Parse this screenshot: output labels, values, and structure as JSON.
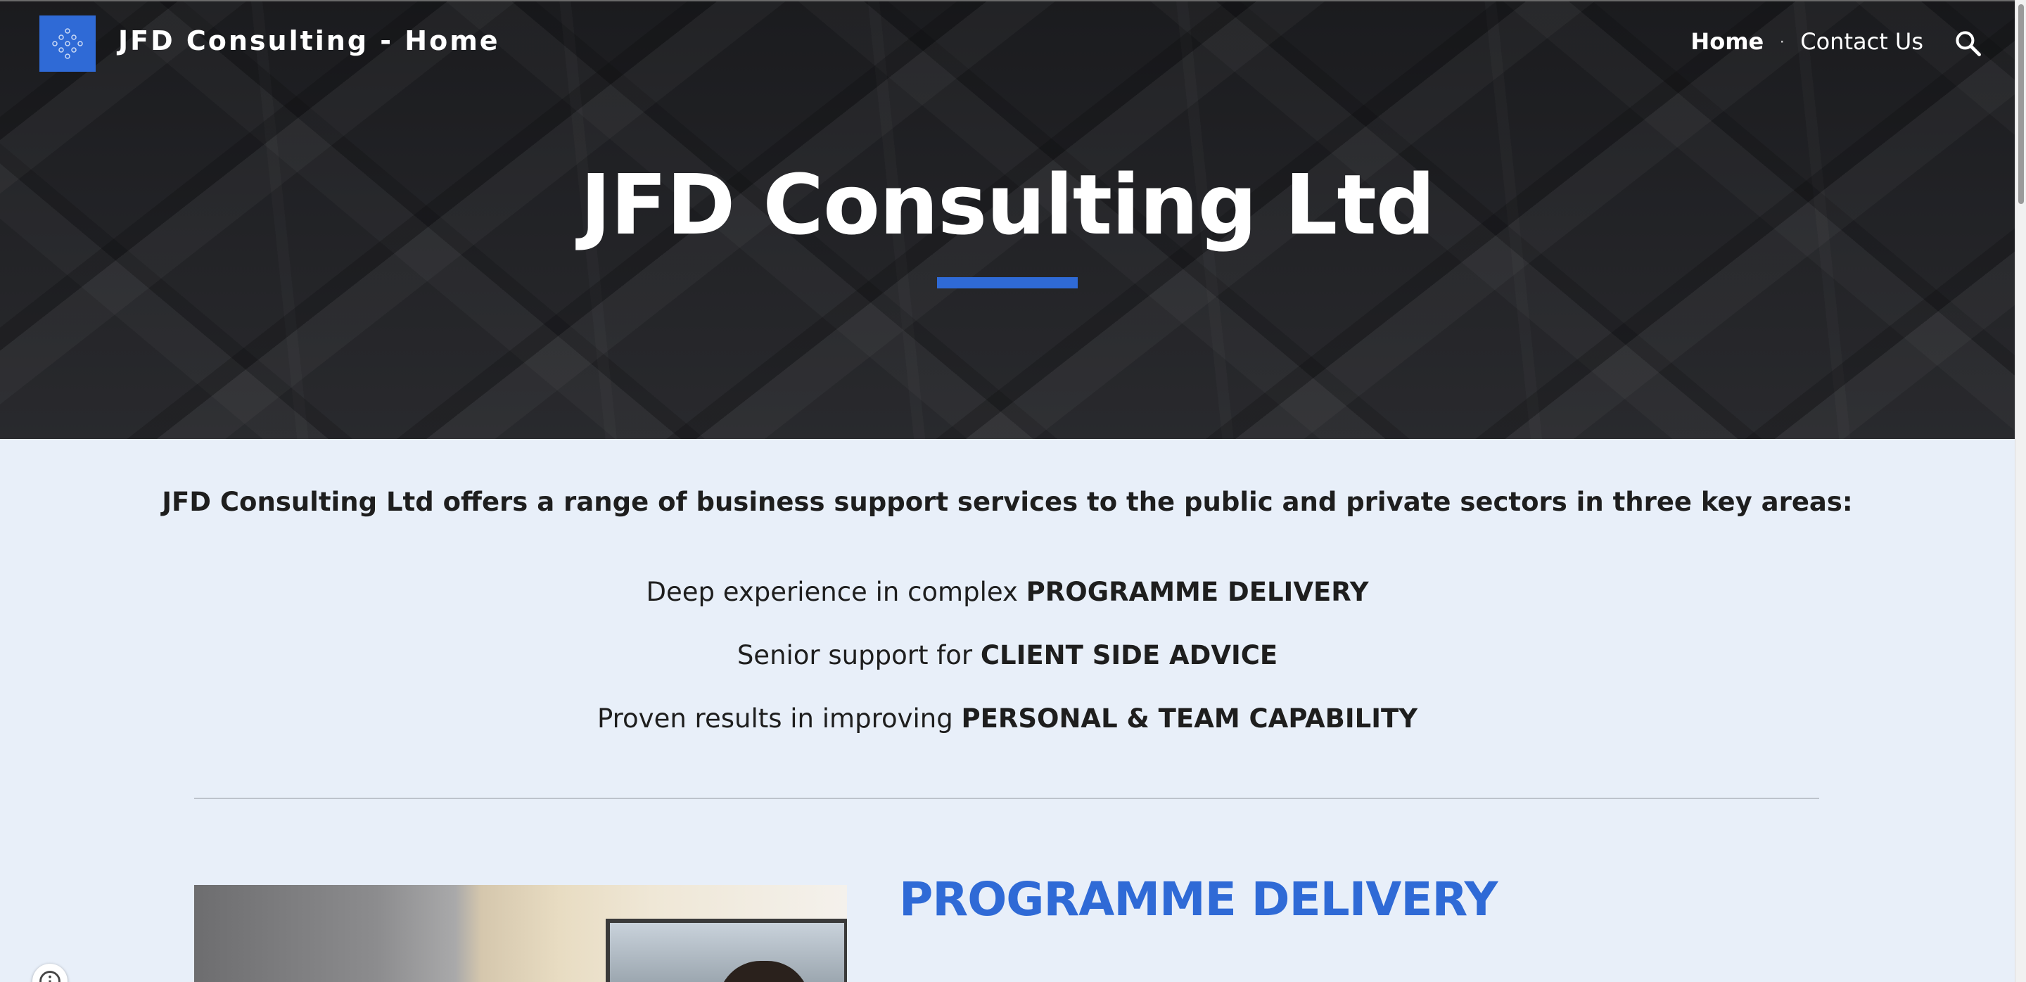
{
  "header": {
    "site_title": "JFD Consulting - Home",
    "nav": [
      {
        "label": "Home",
        "active": true
      },
      {
        "label": "Contact Us",
        "active": false
      }
    ],
    "search_icon": "search-icon",
    "logo_icon": "diamond-dots-icon"
  },
  "hero": {
    "title": "JFD Consulting Ltd"
  },
  "intro": {
    "text": "JFD Consulting Ltd offers a range of business support services to the public and private sectors in three key areas:"
  },
  "services": [
    {
      "prefix": "Deep experience in complex ",
      "emphasis": "PROGRAMME DELIVERY"
    },
    {
      "prefix": "Senior support for ",
      "emphasis": "CLIENT SIDE ADVICE"
    },
    {
      "prefix": "Proven results in improving ",
      "emphasis": "PERSONAL & TEAM CAPABILITY"
    }
  ],
  "section": {
    "title": "PROGRAMME DELIVERY"
  },
  "colors": {
    "accent": "#2f6ad6",
    "page_background": "#e8eff9",
    "hero_background": "#2b2c30",
    "text": "#1e1e1e"
  },
  "floating": {
    "info_icon": "info-icon"
  }
}
